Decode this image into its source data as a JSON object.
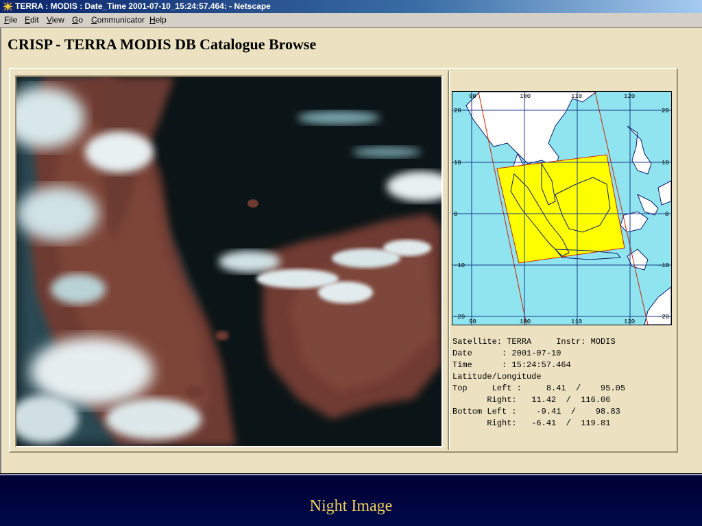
{
  "window": {
    "title": "TERRA : MODIS : Date_Time 2001-07-10_15:24:57.464: - Netscape",
    "icon": "netscape-star-icon"
  },
  "menu": [
    "File",
    "Edit",
    "View",
    "Go",
    "Communicator",
    "Help"
  ],
  "page": {
    "title": "CRISP - TERRA MODIS DB Catalogue Browse"
  },
  "map": {
    "lon_labels_top": [
      "90",
      "100",
      "110",
      "120"
    ],
    "lon_labels_bottom": [
      "90",
      "100",
      "110",
      "120"
    ],
    "lat_labels_left": [
      "20",
      "10",
      "0",
      "-10",
      "-20"
    ],
    "lat_labels_right": [
      "20",
      "10",
      "0",
      "-10",
      "-20"
    ],
    "footprint_color": "#ffff00",
    "swath_color": "#cc2200",
    "sea_color": "#8fe4ef"
  },
  "info": {
    "satellite_line": "Satellite: TERRA     Instr: MODIS",
    "date_line": "Date      : 2001-07-10",
    "time_line": "Time      : 15:24:57.464",
    "latlon_header": "Latitude/Longitude",
    "top_left_line": "Top     Left :     8.41  /    95.05",
    "top_right_line": "       Right:   11.42  /  116.06",
    "bottom_left_line": "Bottom Left :    -9.41  /    98.83",
    "bottom_right_line": "       Right:   -6.41  /  119.81"
  },
  "slide": {
    "caption": "Night Image"
  }
}
